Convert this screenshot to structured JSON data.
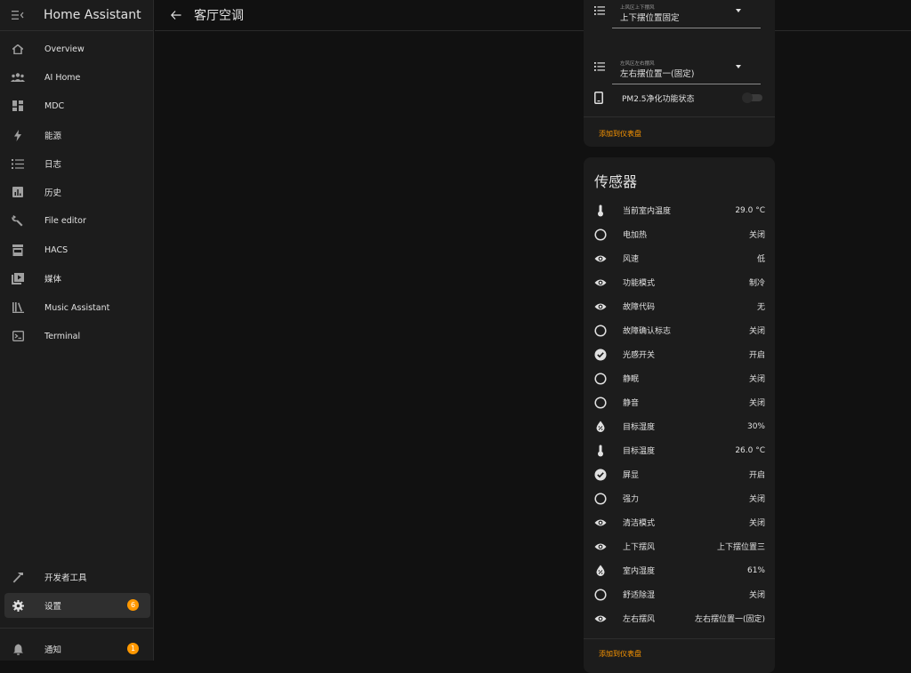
{
  "app": {
    "title": "Home Assistant"
  },
  "page": {
    "title": "客厅空调"
  },
  "sidebar": {
    "items": [
      {
        "label": "Overview",
        "icon": "home-icon"
      },
      {
        "label": "AI Home",
        "icon": "people-icon"
      },
      {
        "label": "MDC",
        "icon": "dashboard-icon"
      },
      {
        "label": "能源",
        "icon": "lightning-icon"
      },
      {
        "label": "日志",
        "icon": "list-icon"
      },
      {
        "label": "历史",
        "icon": "chart-icon"
      },
      {
        "label": "File editor",
        "icon": "wrench-icon"
      },
      {
        "label": "HACS",
        "icon": "hacs-icon"
      },
      {
        "label": "媒体",
        "icon": "media-icon"
      },
      {
        "label": "Music Assistant",
        "icon": "library-icon"
      },
      {
        "label": "Terminal",
        "icon": "terminal-icon"
      }
    ],
    "dev_tools": "开发者工具",
    "settings": {
      "label": "设置",
      "badge": "6"
    },
    "notifications": {
      "label": "通知",
      "badge": "1"
    }
  },
  "controls_card": {
    "selects": [
      {
        "small": "上风区上下摆风",
        "value": "上下摆位置固定"
      },
      {
        "small": "左风区左右摆风",
        "value": "左右摆位置一(固定)"
      }
    ],
    "switch_label": "PM2.5净化功能状态",
    "add_link": "添加到仪表盘"
  },
  "sensors_card": {
    "title": "传感器",
    "rows": [
      {
        "label": "当前室内温度",
        "value": "29.0 °C",
        "icon": "thermometer-icon"
      },
      {
        "label": "电加热",
        "value": "关闭",
        "icon": "circle-outline-icon"
      },
      {
        "label": "风速",
        "value": "低",
        "icon": "eye-icon"
      },
      {
        "label": "功能模式",
        "value": "制冷",
        "icon": "eye-icon"
      },
      {
        "label": "故障代码",
        "value": "无",
        "icon": "eye-icon"
      },
      {
        "label": "故障确认标志",
        "value": "关闭",
        "icon": "circle-outline-icon"
      },
      {
        "label": "光感开关",
        "value": "开启",
        "icon": "check-circle-icon"
      },
      {
        "label": "静眠",
        "value": "关闭",
        "icon": "circle-outline-icon"
      },
      {
        "label": "静音",
        "value": "关闭",
        "icon": "circle-outline-icon"
      },
      {
        "label": "目标湿度",
        "value": "30%",
        "icon": "water-percent-icon"
      },
      {
        "label": "目标温度",
        "value": "26.0 °C",
        "icon": "thermometer-icon"
      },
      {
        "label": "屏显",
        "value": "开启",
        "icon": "check-circle-icon"
      },
      {
        "label": "强力",
        "value": "关闭",
        "icon": "circle-outline-icon"
      },
      {
        "label": "清洁模式",
        "value": "关闭",
        "icon": "eye-icon"
      },
      {
        "label": "上下摆风",
        "value": "上下摆位置三",
        "icon": "eye-icon"
      },
      {
        "label": "室内湿度",
        "value": "61%",
        "icon": "water-percent-icon"
      },
      {
        "label": "舒适除湿",
        "value": "关闭",
        "icon": "circle-outline-icon"
      },
      {
        "label": "左右摆风",
        "value": "左右摆位置一(固定)",
        "icon": "eye-icon"
      }
    ],
    "add_link": "添加到仪表盘"
  },
  "colors": {
    "accent": "#ff9800",
    "background": "#111111",
    "card": "#1c1c1c"
  }
}
